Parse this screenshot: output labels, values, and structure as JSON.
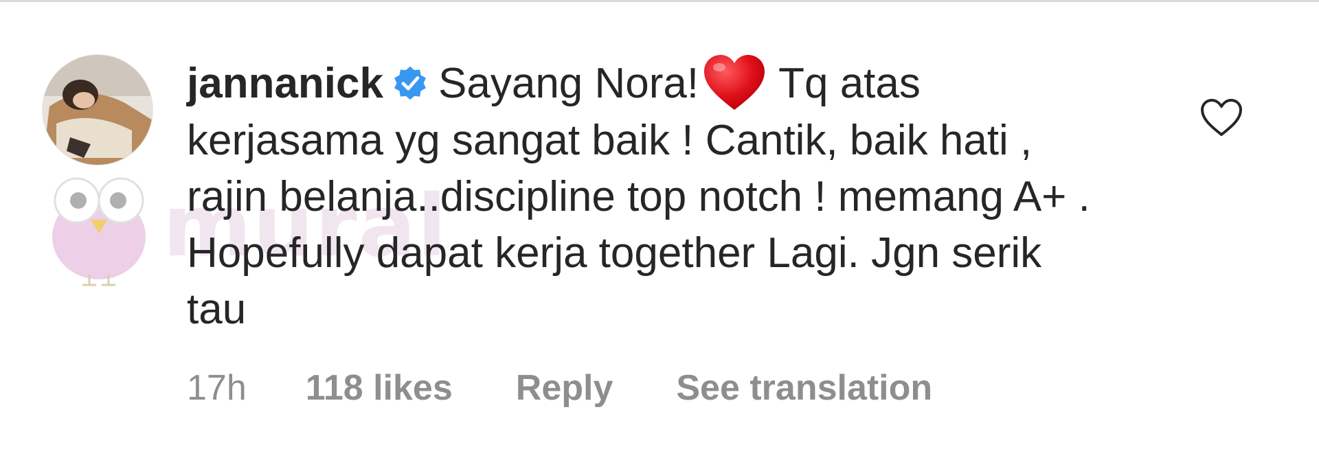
{
  "comment": {
    "username": "jannanick",
    "verified": true,
    "text_part1": "Sayang Nora!",
    "emoji": "heart-emoji",
    "text_part2": "Tq atas kerjasama yg sangat baik ! Cantik, baik hati , rajin belanja..discipline top notch ! memang A+ . Hopefully dapat kerja together Lagi. Jgn serik tau",
    "time": "17h",
    "likes": "118 likes",
    "reply_label": "Reply",
    "translate_label": "See translation"
  },
  "watermark": {
    "text": "mural"
  },
  "icons": {
    "verified": "verified-badge-icon",
    "like": "heart-outline-icon",
    "watermark": "owl-logo-icon"
  },
  "colors": {
    "text": "#262626",
    "muted": "#8e8e8e",
    "verified": "#3897f0",
    "heart_emoji": "#e0101a",
    "divider": "#dbdbdb"
  }
}
